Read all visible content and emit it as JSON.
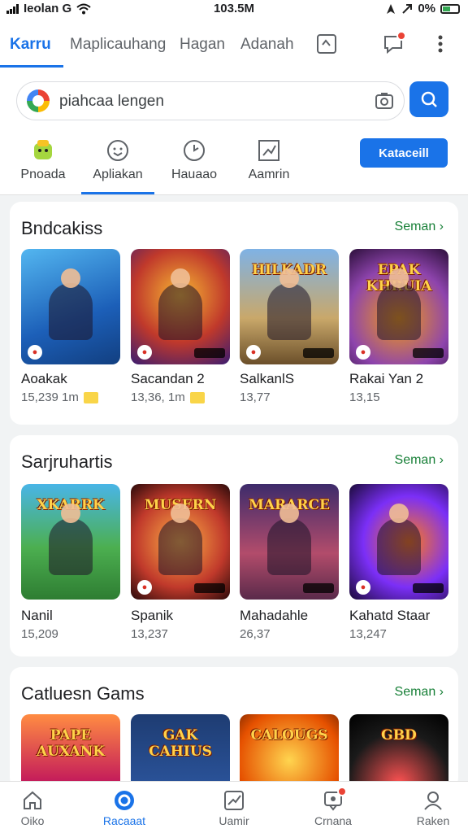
{
  "status_bar": {
    "carrier": "Ieolan G",
    "time": "103.5M",
    "battery": "0%"
  },
  "top_tabs": [
    "Karru",
    "Maplicauhang",
    "Hagan",
    "Adanah"
  ],
  "search": {
    "placeholder": "piahcaa lengen"
  },
  "categories": [
    "Pnoada",
    "Apliakan",
    "Hauaao",
    "Aamrin"
  ],
  "install_label": "Kataceill",
  "sections": [
    {
      "title": "Bndcakiss",
      "more": "Seman ›",
      "apps": [
        {
          "name": "Aoakak",
          "meta": "15,239 1m"
        },
        {
          "name": "Sacandan 2",
          "meta": "13,36, 1m"
        },
        {
          "name": "SalkanlS",
          "meta": "13,77"
        },
        {
          "name": "Rakai Yan 2",
          "meta": "13,15"
        }
      ]
    },
    {
      "title": "Sarjruhartis",
      "more": "Seman ›",
      "apps": [
        {
          "name": "Nanil",
          "meta": "15,209"
        },
        {
          "name": "Spanik",
          "meta": "13,237"
        },
        {
          "name": "Mahadahle",
          "meta": "26,37"
        },
        {
          "name": "Kahatd Staar",
          "meta": "13,247"
        }
      ]
    },
    {
      "title": "Catluesn Gams",
      "more": "Seman ›",
      "apps": [
        {},
        {},
        {},
        {}
      ]
    }
  ],
  "tile_logos": [
    "",
    "",
    "HILKADR",
    "EPAK KHRUIA",
    "XKARRK",
    "MUSERN",
    "MARARCE",
    "",
    "PAPE AUXANK",
    "GAK CAHIUS",
    "CALOUGS",
    "GBD"
  ],
  "bottom_nav": [
    "Oiko",
    "Racaaat",
    "Uamir",
    "Crnana",
    "Raken"
  ]
}
